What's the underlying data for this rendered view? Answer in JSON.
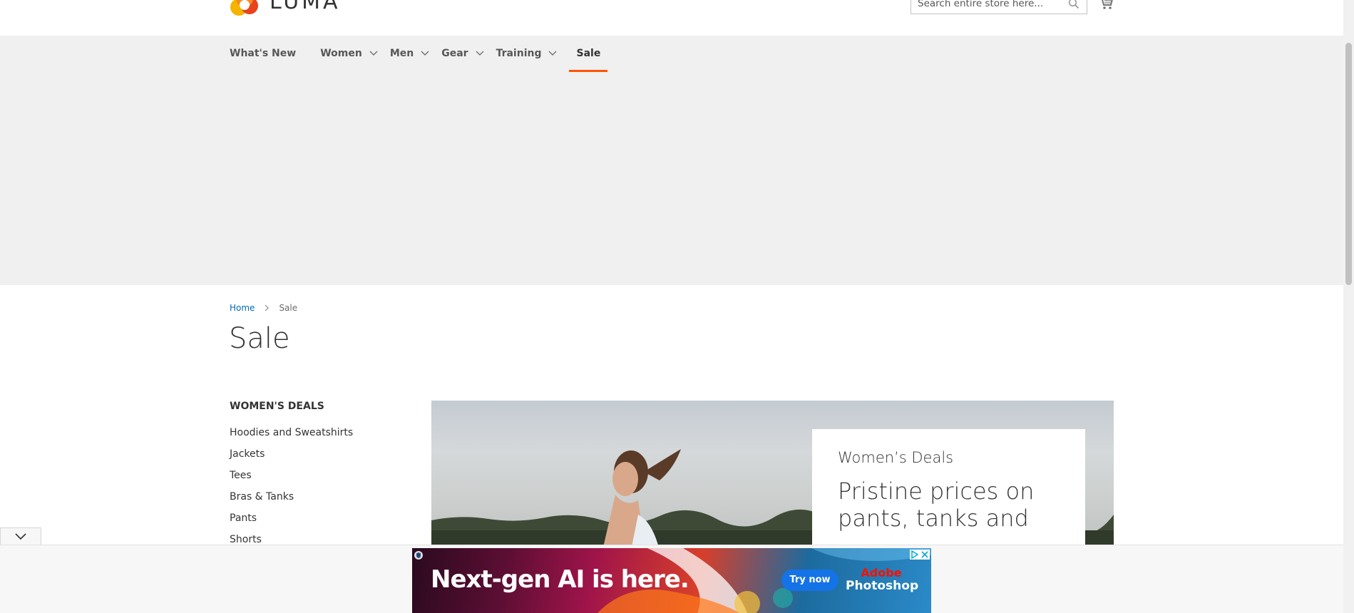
{
  "header": {
    "logo_text": "LUMA",
    "search": {
      "placeholder": "Search entire store here..."
    }
  },
  "nav": {
    "items": [
      {
        "label": "What's New",
        "has_submenu": false,
        "active": false
      },
      {
        "label": "Women",
        "has_submenu": true,
        "active": false
      },
      {
        "label": "Men",
        "has_submenu": true,
        "active": false
      },
      {
        "label": "Gear",
        "has_submenu": true,
        "active": false
      },
      {
        "label": "Training",
        "has_submenu": true,
        "active": false
      },
      {
        "label": "Sale",
        "has_submenu": false,
        "active": true
      }
    ],
    "active_color": "#ff5501"
  },
  "breadcrumb": {
    "home": "Home",
    "current": "Sale"
  },
  "page": {
    "title": "Sale"
  },
  "sidebar": {
    "heading": "WOMEN'S DEALS",
    "items": [
      "Hoodies and Sweatshirts",
      "Jackets",
      "Tees",
      "Bras & Tanks",
      "Pants",
      "Shorts"
    ]
  },
  "banner": {
    "kicker": "Women’s Deals",
    "headline": "Pristine prices on pants, tanks and"
  },
  "ad": {
    "headline": "Next-gen AI is here.",
    "cta": "Try now",
    "brand_line1": "Adobe",
    "brand_line2": "Photoshop"
  },
  "icons": {
    "search": "search-icon",
    "cart": "cart-icon",
    "chevron": "chevron-down-icon",
    "breadcrumb_sep": "chevron-right-icon",
    "collapse": "chevron-down-icon"
  },
  "colors": {
    "link": "#006bb4",
    "nav_bg": "#f0f0f0",
    "ad_button": "#1473e6"
  }
}
